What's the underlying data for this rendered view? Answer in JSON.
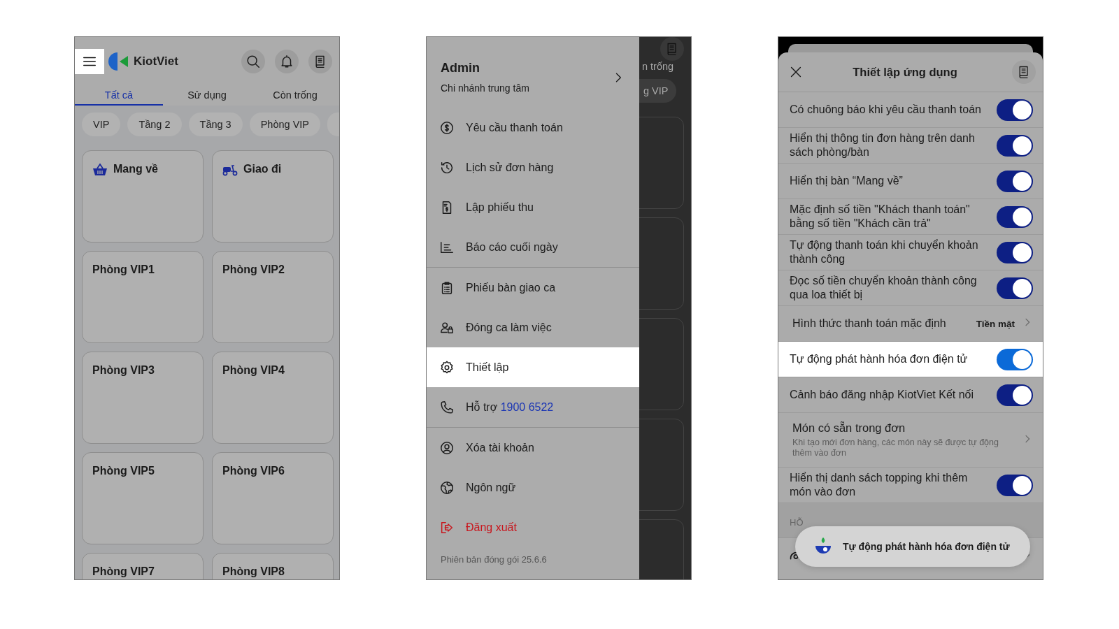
{
  "home": {
    "app_name": "KiotViet",
    "tabs": [
      {
        "label": "Tất cả",
        "selected": true
      },
      {
        "label": "Sử dụng",
        "selected": false
      },
      {
        "label": "Còn trống",
        "selected": false
      }
    ],
    "chips": [
      "VIP",
      "Tầng 2",
      "Tầng 3",
      "Phòng VIP"
    ],
    "tables": [
      {
        "name": "Mang về",
        "kind": "takeaway"
      },
      {
        "name": "Giao đi",
        "kind": "delivery"
      },
      {
        "name": "Phòng VIP1",
        "kind": "room"
      },
      {
        "name": "Phòng VIP2",
        "kind": "room"
      },
      {
        "name": "Phòng VIP3",
        "kind": "room"
      },
      {
        "name": "Phòng VIP4",
        "kind": "room"
      },
      {
        "name": "Phòng VIP5",
        "kind": "room"
      },
      {
        "name": "Phòng VIP6",
        "kind": "room"
      },
      {
        "name": "Phòng VIP7",
        "kind": "room"
      },
      {
        "name": "Phòng VIP8",
        "kind": "room"
      }
    ]
  },
  "drawer": {
    "user": "Admin",
    "branch": "Chi nhánh trung tâm",
    "sections": [
      {
        "items": [
          {
            "kind": "payment",
            "label": "Yêu cầu thanh toán",
            "selected": false
          },
          {
            "kind": "history",
            "label": "Lịch sử đơn hàng",
            "selected": false
          },
          {
            "kind": "receipt",
            "label": "Lập phiếu thu",
            "selected": false
          },
          {
            "kind": "report",
            "label": "Báo cáo cuối ngày",
            "selected": false
          }
        ]
      },
      {
        "items": [
          {
            "kind": "handover",
            "label": "Phiếu bàn giao ca",
            "selected": false
          },
          {
            "kind": "shift",
            "label": "Đóng ca làm việc",
            "selected": false
          },
          {
            "kind": "settings",
            "label": "Thiết lập",
            "selected": true
          },
          {
            "kind": "support",
            "label": "Hỗ trợ",
            "phone": "1900 6522",
            "selected": false
          }
        ]
      },
      {
        "items": [
          {
            "kind": "account",
            "label": "Xóa tài khoản",
            "selected": false
          },
          {
            "kind": "language",
            "label": "Ngôn ngữ",
            "selected": false
          },
          {
            "kind": "logout",
            "label": "Đăng xuất",
            "selected": false
          }
        ]
      }
    ],
    "version": "Phiên bản đóng gói 25.6.6",
    "backdrop": {
      "tab_fragment": "n trống",
      "chip_fragment": "g VIP"
    }
  },
  "settings": {
    "title": "Thiết lập ứng dụng",
    "rows": [
      {
        "kind": "toggle",
        "label": "Có chuông báo khi yêu cầu thanh toán",
        "on": true,
        "highlighted": false
      },
      {
        "kind": "toggle",
        "label": "Hiển thị thông tin đơn hàng trên danh sách phòng/bàn",
        "on": true,
        "highlighted": false
      },
      {
        "kind": "toggle",
        "label": "Hiển thị bàn “Mang về”",
        "on": true,
        "highlighted": false
      },
      {
        "kind": "toggle",
        "label": "Mặc định số tiền \"Khách thanh toán\" bằng số tiền \"Khách cần trả\"",
        "on": true,
        "highlighted": false
      },
      {
        "kind": "toggle",
        "label": "Tự động thanh toán khi chuyển khoản thành công",
        "on": true,
        "highlighted": false
      },
      {
        "kind": "toggle",
        "label": "Đọc số tiền chuyển khoản thành công qua loa thiết bị",
        "on": true,
        "highlighted": false
      },
      {
        "kind": "value",
        "label": "Hình thức thanh toán mặc định",
        "value": "Tiền mặt",
        "highlighted": false
      },
      {
        "kind": "toggle",
        "label": "Tự động phát hành hóa đơn điện tử",
        "on": true,
        "highlighted": true
      },
      {
        "kind": "toggle",
        "label": "Cảnh báo đăng nhập KiotViet Kết nối",
        "on": true,
        "highlighted": false
      },
      {
        "kind": "detail",
        "label": "Món có sẵn trong đơn",
        "description": "Khi tạo mới đơn hàng, các món này sẽ được tự động thêm vào đơn",
        "highlighted": false
      },
      {
        "kind": "toggle",
        "label": "Hiển thị danh sách topping khi thêm món vào đơn",
        "on": true,
        "highlighted": false
      }
    ],
    "section_label": "HỖ",
    "toast": "Tự động phát hành hóa đơn điện tử"
  }
}
